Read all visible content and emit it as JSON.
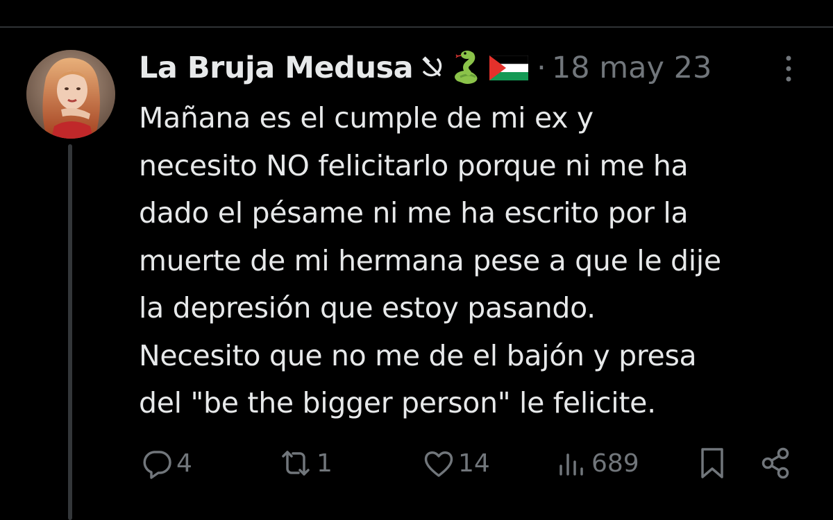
{
  "tweet": {
    "author": {
      "display_name": "La Bruja Medusa",
      "name_emoji_icons": [
        "hammer-sickle-icon",
        "snake-icon",
        "palestine-flag-icon"
      ]
    },
    "separator": "·",
    "timestamp": "18 may 23",
    "text": "Mañana es el cumple de mi ex y\nnecesito NO felicitarlo porque ni me ha\ndado el pésame ni me ha escrito por la\nmuerte de mi hermana pese a que le dije\nla depresión que estoy pasando.\nNecesito que no me de el bajón y presa\ndel \"be the bigger person\" le felicite.",
    "actions": {
      "replies": "4",
      "reposts": "1",
      "likes": "14",
      "views": "689"
    }
  },
  "colors": {
    "background": "#000000",
    "text_primary": "#e7e9ea",
    "text_secondary": "#71767b",
    "divider": "#2f3336"
  }
}
